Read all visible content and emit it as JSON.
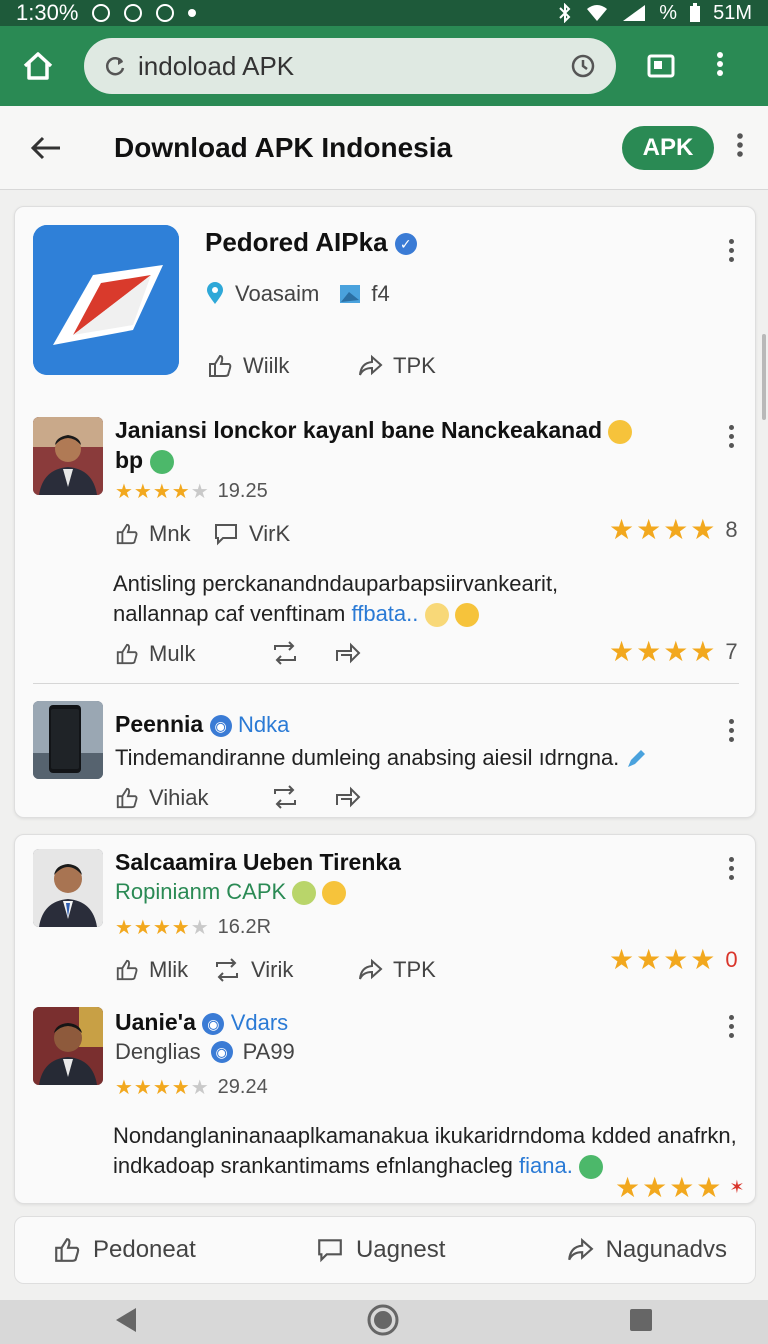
{
  "status_bar": {
    "time": "1:30%",
    "right_text": "51M",
    "battery_text": "%"
  },
  "browser": {
    "url": "indoload APK"
  },
  "header": {
    "title": "Download APK Indonesia",
    "apk_button": "APK"
  },
  "app": {
    "name": "Pedored AIPka",
    "developer": "Voasaim",
    "version": "f4",
    "action_like": "Wiilk",
    "action_share": "TPK"
  },
  "reviews": [
    {
      "name_line1": "Janiansi lonckor kayanl bane Nanckeakanad",
      "name_line2": "bp",
      "rating": 3.5,
      "rating_text": "19.25",
      "like": "Mnk",
      "comment": "VirK",
      "right_stars": 4,
      "right_count": "8",
      "text_line1": "Antisling perckanandndauparbapsiirvankearit,",
      "text_line2": "nallannap caf venftinam",
      "text_link": "ffbata..",
      "like2": "Mulk",
      "right_stars2": 4,
      "right_count2": "7"
    }
  ],
  "device_item": {
    "name": "Peennia",
    "tag": "Ndka",
    "text": "Tindemandiranne dumleing anabsing aiesil ıdrngna.",
    "like": "Vihiak"
  },
  "card2": {
    "reviewer1": {
      "name": "Salcaamira Ueben Tirenka",
      "sub": "Ropinianm CAPK",
      "rating": 3.5,
      "rating_text": "16.2R",
      "like": "Mlik",
      "comment": "Virik",
      "share": "TPK",
      "right_stars": 4,
      "right_count": "0"
    },
    "reviewer2": {
      "name": "Uanie'a",
      "tag": "Vdars",
      "sub": "Denglias",
      "sub_tag": "PA99",
      "rating": 3.5,
      "rating_text": "29.24",
      "text_line1": "Nondanglaninanaaplkamanakua ikukaridrndoma kdded anafrkn,",
      "text_line2": "indkadoap srankantimams efnlanghacleg",
      "text_link": "fiana.",
      "right_stars": 4
    }
  },
  "bottom_actions": {
    "like": "Pedoneat",
    "comment": "Uagnest",
    "share": "Nagunadvs"
  },
  "colors": {
    "brand_green": "#2a8a54",
    "star": "#f2a81e",
    "link": "#2a7ad5"
  }
}
